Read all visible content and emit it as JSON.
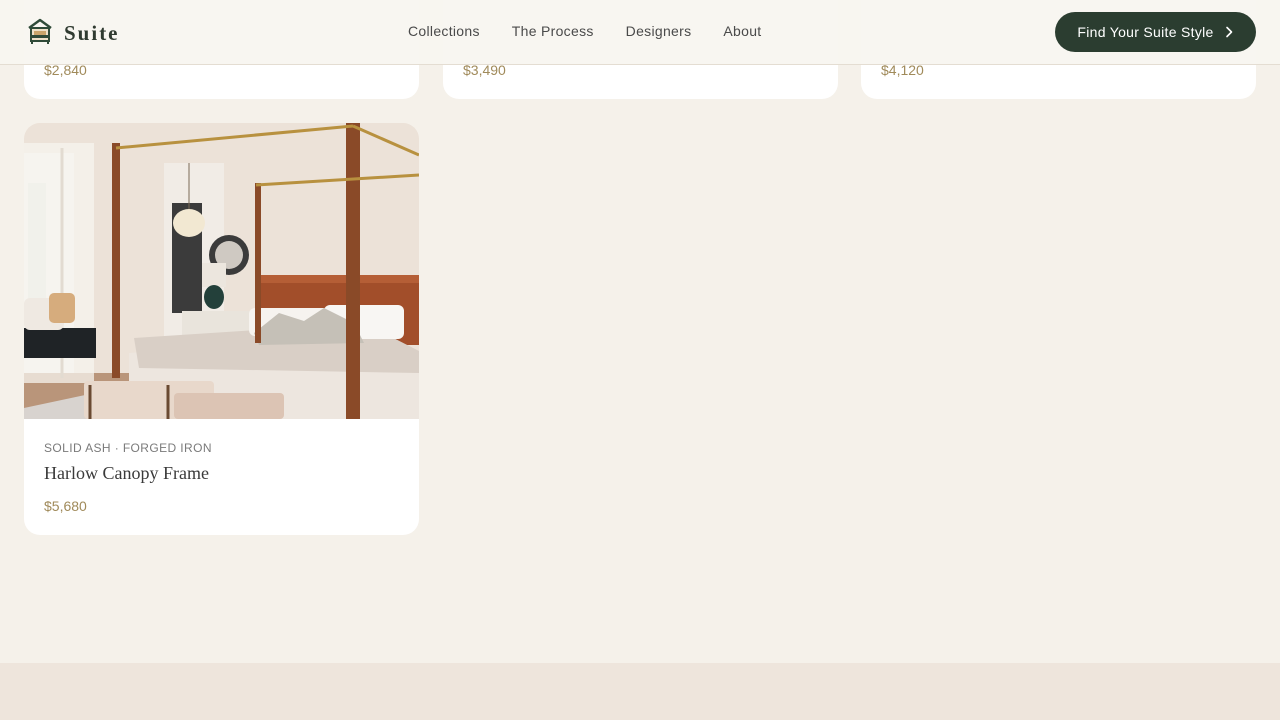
{
  "header": {
    "brand": "Suite",
    "nav": [
      "Collections",
      "The Process",
      "Designers",
      "About"
    ],
    "cta_label": "Find Your Suite Style"
  },
  "products_partial": [
    {
      "price": "$2,840"
    },
    {
      "price": "$3,490"
    },
    {
      "price": "$4,120"
    }
  ],
  "featured_product": {
    "materials": "SOLID ASH · FORGED IRON",
    "name": "Harlow Canopy Frame",
    "price": "$5,680"
  },
  "colors": {
    "background": "#f5f1ea",
    "card": "#ffffff",
    "cta": "#2b3d30",
    "price": "#a08a5a",
    "footer_band": "#eee5dc"
  },
  "icons": {
    "logo": "bed-house-icon",
    "cta_arrow": "chevron-right-icon"
  }
}
